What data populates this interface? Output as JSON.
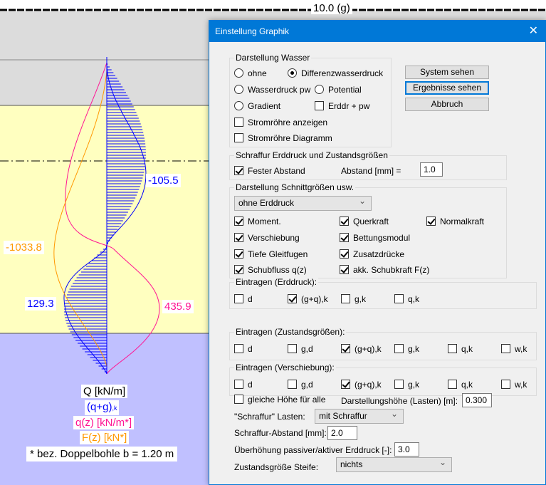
{
  "top_label": "10.0 (g)",
  "chart": {
    "val_q_top": "-105.5",
    "val_f": "-1033.8",
    "val_q_bottom": "129.3",
    "val_qz": "435.9"
  },
  "legend": {
    "q": "Q [kN/m]",
    "qg": "(q+g)",
    "qg_sub": ",k",
    "qz": "q(z) [kN/m*]",
    "fz": "F(z) [kN*]",
    "note": "* bez. Doppelbohle b = 1.20 m"
  },
  "colors": {
    "blue": "#0000ff",
    "magenta": "#ff1493",
    "orange": "#ff9900",
    "yellow": "#ffffc0",
    "purple": "#c0c0ff",
    "grey": "#dcdcdc"
  },
  "dialog": {
    "title": "Einstellung Graphik",
    "buttons": {
      "system": "System sehen",
      "results": "Ergebnisse sehen",
      "cancel": "Abbruch"
    },
    "wasser": {
      "title": "Darstellung Wasser",
      "ohne": "ohne",
      "diff": "Differenzwasserdruck",
      "pw": "Wasserdruck pw",
      "potential": "Potential",
      "gradient": "Gradient",
      "erddr": "Erddr + pw",
      "strom_anz": "Stromröhre anzeigen",
      "strom_diag": "Stromröhre Diagramm"
    },
    "schraffur": {
      "title": "Schraffur Erddruck und Zustandsgrößen",
      "fest": "Fester Abstand",
      "abstand_label": "Abstand [mm] =",
      "abstand": "1.0"
    },
    "schnitt": {
      "title": "Darstellung Schnittgrößen usw.",
      "select": "ohne Erddruck",
      "moment": "Moment.",
      "querkraft": "Querkraft",
      "normalkraft": "Normalkraft",
      "verschiebung": "Verschiebung",
      "bettung": "Bettungsmodul",
      "tiefe": "Tiefe Gleitfugen",
      "zusatz": "Zusatzdrücke",
      "schubfluss": "Schubfluss q(z)",
      "schubkraft": "akk. Schubkraft F(z)"
    },
    "erddruck": {
      "title": "Eintragen (Erddruck):",
      "items": [
        "d",
        "(g+q),k",
        "g,k",
        "q,k"
      ],
      "checked": [
        false,
        true,
        false,
        false
      ]
    },
    "zustand": {
      "title": "Eintragen (Zustandsgrößen):",
      "items": [
        "d",
        "g,d",
        "(g+q),k",
        "g,k",
        "q,k",
        "w,k"
      ],
      "checked": [
        false,
        false,
        true,
        false,
        false,
        false
      ]
    },
    "verschiebung": {
      "title": "Eintragen (Verschiebung):",
      "items": [
        "d",
        "g,d",
        "(g+q),k",
        "g,k",
        "q,k",
        "w,k"
      ],
      "checked": [
        false,
        false,
        true,
        false,
        false,
        false
      ]
    },
    "bottom": {
      "gleich": "gleiche Höhe für alle",
      "hoehe_label": "Darstellungshöhe (Lasten) [m]:",
      "hoehe": "0.300",
      "schraffur_label": "\"Schraffur\" Lasten:",
      "schraffur_sel": "mit Schraffur",
      "abstand_label": "Schraffur-Abstand [mm]:",
      "abstand": "2.0",
      "ueber_label": "Überhöhung passiver/aktiver Erddruck [-]:",
      "ueber": "3.0",
      "steife_label": "Zustandsgröße Steife:",
      "steife_sel": "nichts"
    }
  }
}
